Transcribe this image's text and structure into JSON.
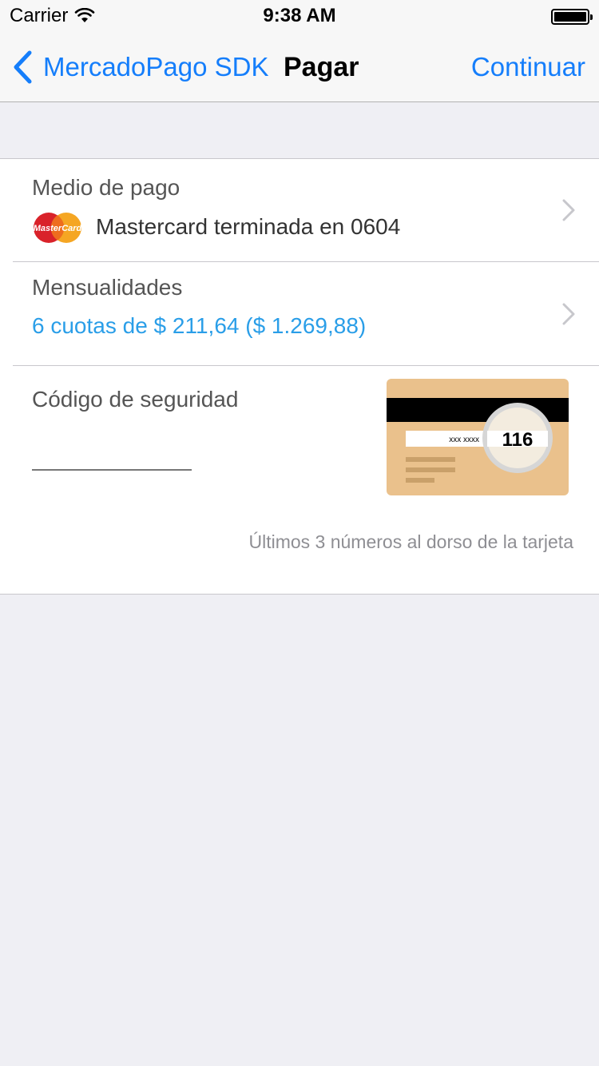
{
  "status_bar": {
    "carrier": "Carrier",
    "time": "9:38 AM"
  },
  "nav": {
    "back_label": "MercadoPago SDK",
    "title": "Pagar",
    "continue_label": "Continuar"
  },
  "payment_method": {
    "label": "Medio de pago",
    "card_brand_logo_text": "MasterCard",
    "value": "Mastercard terminada en 0604"
  },
  "installments": {
    "label": "Mensualidades",
    "value": "6 cuotas de $ 211,64 ($ 1.269,88)"
  },
  "security_code": {
    "label": "Código de seguridad",
    "input_value": "",
    "card_masked_number": "xxx xxxx",
    "card_cvv_example": "116",
    "hint": "Últimos 3 números al dorso de la tarjeta"
  },
  "colors": {
    "accent": "#157efb",
    "installments_text": "#2a9ee8",
    "card_body": "#eac18c",
    "background": "#efeff4"
  },
  "icons": [
    "wifi-icon",
    "battery-icon",
    "back-chevron-icon",
    "mastercard-logo",
    "chevron-right-icon",
    "security-card-illustration"
  ]
}
